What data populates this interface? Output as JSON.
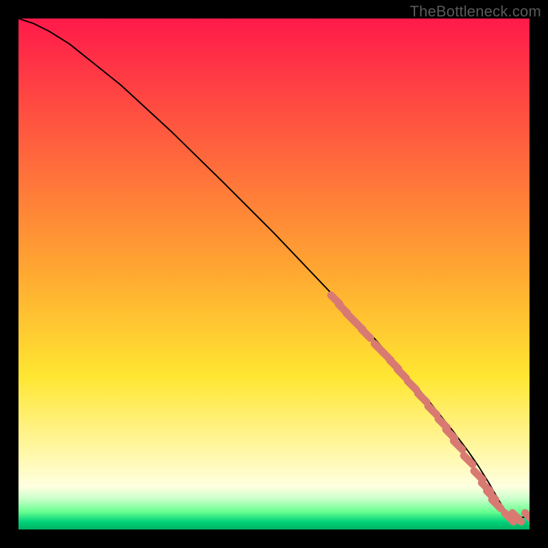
{
  "watermark": "TheBottleneck.com",
  "colors": {
    "background_black": "#000000",
    "curve": "#000000",
    "marker_fill": "#d97a72",
    "watermark_text": "#5a5a5a",
    "gradient_stops": [
      {
        "offset": 0.0,
        "color": "#ff1a4a"
      },
      {
        "offset": 0.5,
        "color": "#ffa931"
      },
      {
        "offset": 0.7,
        "color": "#ffe631"
      },
      {
        "offset": 0.86,
        "color": "#fff9b0"
      },
      {
        "offset": 0.915,
        "color": "#ffffe0"
      },
      {
        "offset": 0.94,
        "color": "#caffcb"
      },
      {
        "offset": 0.965,
        "color": "#6aff91"
      },
      {
        "offset": 0.985,
        "color": "#00d27a"
      },
      {
        "offset": 1.0,
        "color": "#00b060"
      }
    ]
  },
  "chart_data": {
    "type": "line",
    "title": "",
    "xlabel": "",
    "ylabel": "",
    "xlim": [
      0,
      100
    ],
    "ylim": [
      0,
      100
    ],
    "series": [
      {
        "name": "curve",
        "x": [
          0,
          3,
          6,
          10,
          15,
          20,
          30,
          40,
          50,
          60,
          70,
          80,
          85,
          88,
          90,
          92,
          94,
          96,
          100
        ],
        "y": [
          100,
          99,
          97.5,
          95,
          91,
          87,
          77.8,
          68,
          58,
          47.5,
          37,
          25.5,
          19.3,
          15.3,
          12.4,
          9.2,
          5.7,
          2.4,
          2.4
        ]
      }
    ],
    "markers": {
      "name": "highlight-points",
      "color": "#d97a72",
      "points": [
        {
          "x": 62,
          "y": 45.0
        },
        {
          "x": 63.5,
          "y": 43.2
        },
        {
          "x": 65,
          "y": 41.5
        },
        {
          "x": 66.5,
          "y": 40.0
        },
        {
          "x": 68,
          "y": 38.3
        },
        {
          "x": 70.5,
          "y": 35.5
        },
        {
          "x": 72,
          "y": 34.0
        },
        {
          "x": 73.5,
          "y": 32.3
        },
        {
          "x": 75,
          "y": 30.5
        },
        {
          "x": 77,
          "y": 28.2
        },
        {
          "x": 79,
          "y": 25.8
        },
        {
          "x": 81,
          "y": 23.3
        },
        {
          "x": 83,
          "y": 20.8
        },
        {
          "x": 84.5,
          "y": 18.7
        },
        {
          "x": 86,
          "y": 16.5
        },
        {
          "x": 88,
          "y": 13.6
        },
        {
          "x": 90,
          "y": 10.6
        },
        {
          "x": 91.5,
          "y": 8.3
        },
        {
          "x": 92.5,
          "y": 6.7
        },
        {
          "x": 93.5,
          "y": 5.0
        },
        {
          "x": 96,
          "y": 2.4
        },
        {
          "x": 97.5,
          "y": 2.4
        },
        {
          "x": 100,
          "y": 2.4
        }
      ]
    }
  }
}
